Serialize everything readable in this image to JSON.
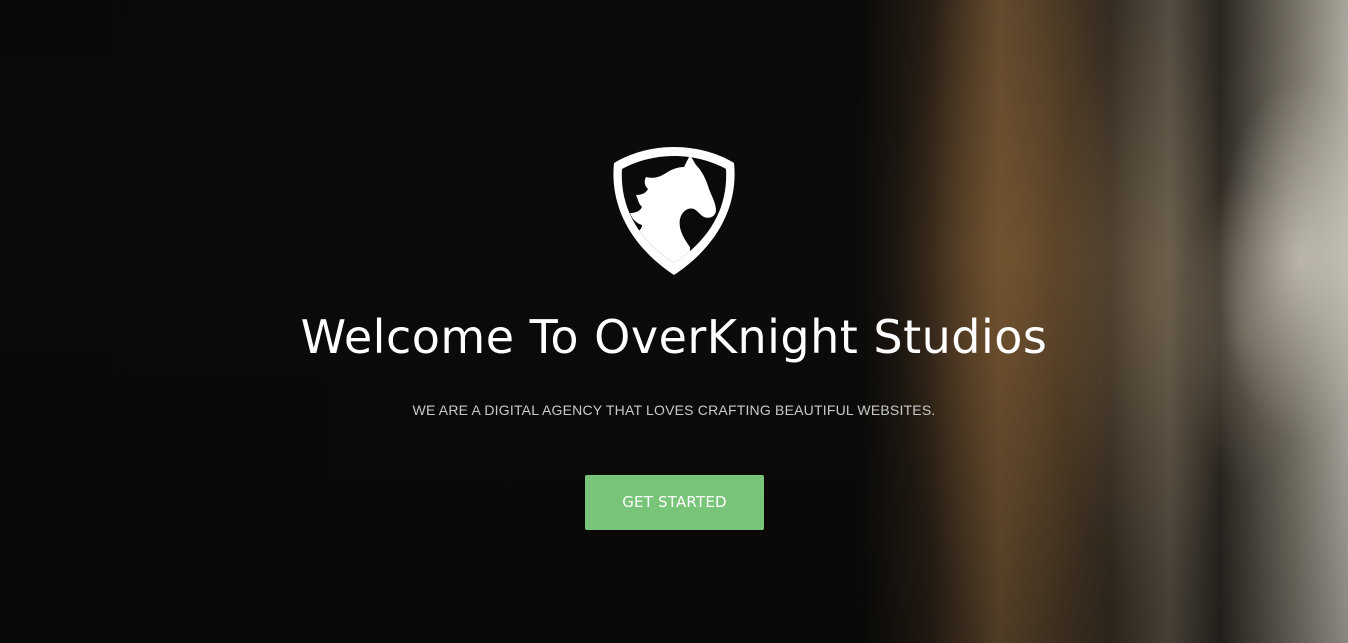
{
  "hero": {
    "logo_icon": "knight-shield-icon",
    "title": "Welcome To OverKnight Studios",
    "tagline": "WE ARE A DIGITAL AGENCY THAT LOVES CRAFTING BEAUTIFUL WEBSITES.",
    "cta_label": "GET STARTED"
  },
  "colors": {
    "background": "#0b0a08",
    "title_text": "#ffffff",
    "tagline_text": "#c9c9c9",
    "cta_background": "#78c478",
    "cta_text": "#ffffff"
  }
}
